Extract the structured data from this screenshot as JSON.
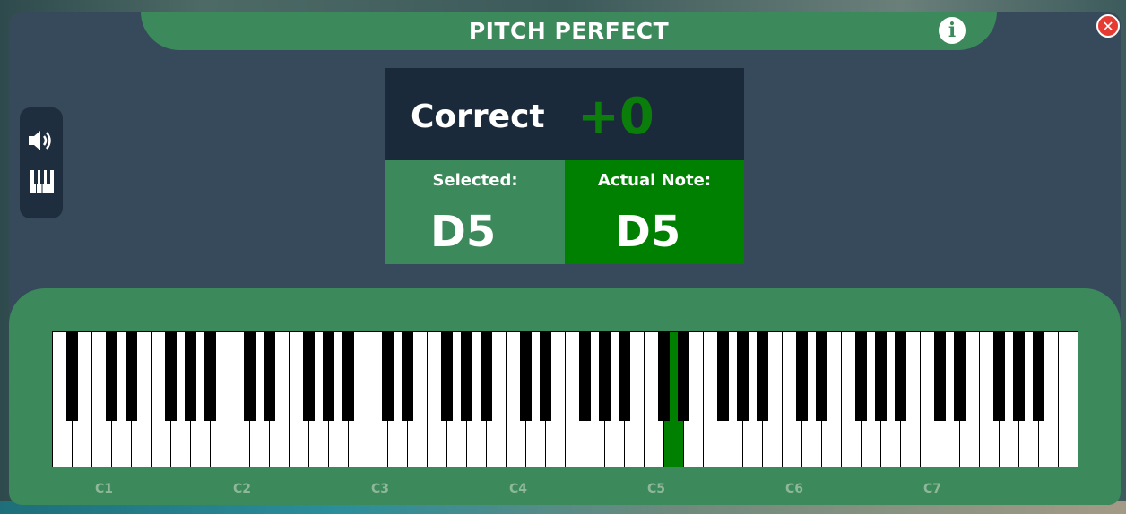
{
  "app": {
    "title": "PITCH PERFECT",
    "info_icon": "info-icon",
    "close_icon": "close-icon"
  },
  "toolbar": {
    "items": [
      {
        "name": "volume",
        "icon": "speaker-icon"
      },
      {
        "name": "keys",
        "icon": "piano-keys-icon"
      }
    ]
  },
  "score": {
    "label": "Correct",
    "value": "+0"
  },
  "selected": {
    "label": "Selected:",
    "note": "D5"
  },
  "actual": {
    "label": "Actual Note:",
    "note": "D5"
  },
  "keyboard": {
    "octave_labels": [
      "C1",
      "C2",
      "C3",
      "C4",
      "C5",
      "C6",
      "C7"
    ],
    "highlighted_note": "D5",
    "highlight_color": "#008000"
  },
  "colors": {
    "panel": "#364a5b",
    "accent_green": "#3c8a5c",
    "correct_green": "#008000",
    "score_bg": "#1a2a3a",
    "close_red": "#e53b33"
  }
}
